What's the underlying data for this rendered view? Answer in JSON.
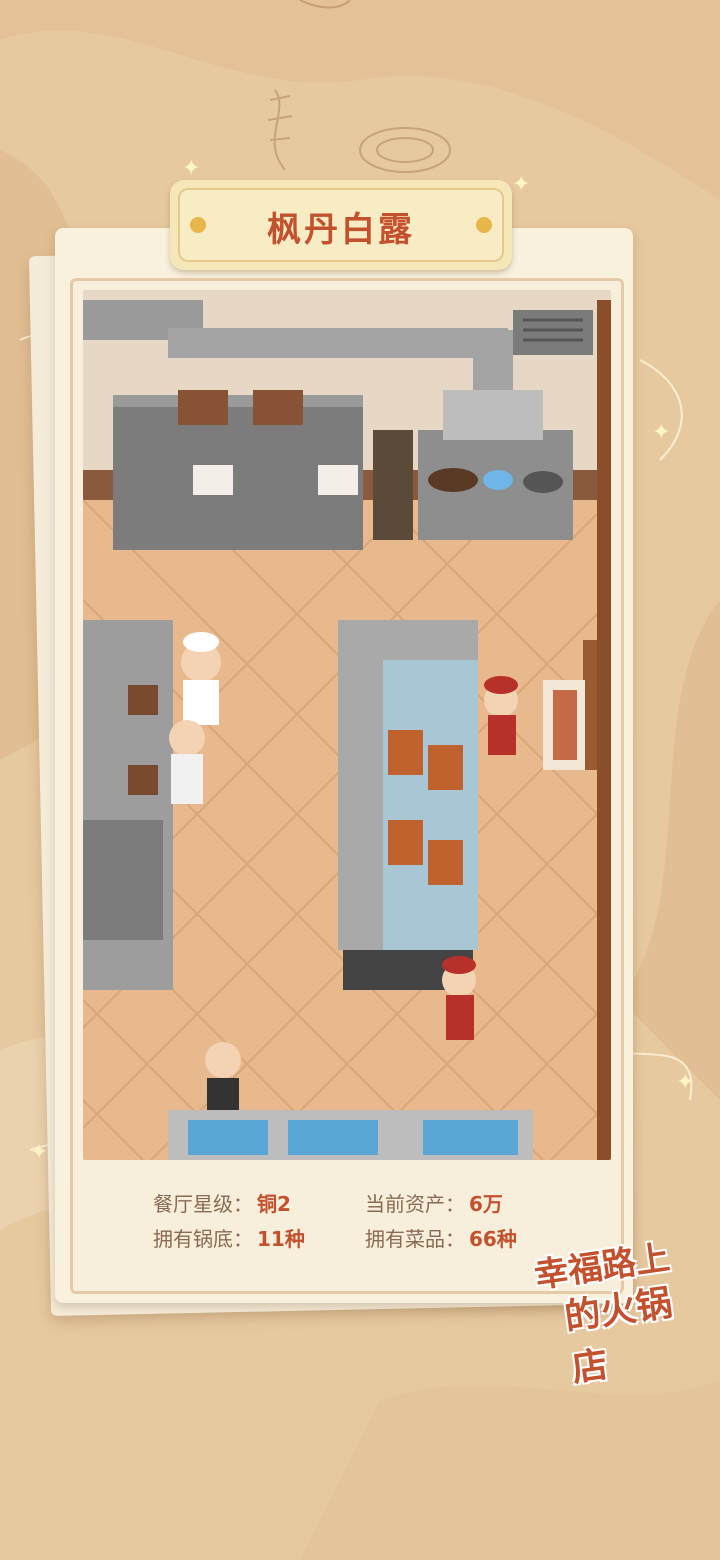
{
  "restaurant": {
    "name": "枫丹白露"
  },
  "stats": {
    "star_level_label": "餐厅星级：",
    "star_level_value": "铜2",
    "assets_label": "当前资产：",
    "assets_value": "6万",
    "soup_bases_label": "拥有锅底：",
    "soup_bases_value": "11种",
    "dishes_label": "拥有菜品：",
    "dishes_value": "66种"
  },
  "logo": {
    "line1": "幸福路上",
    "line2": "的火锅店"
  },
  "colors": {
    "accent": "#c4512e",
    "label": "#8a6a52",
    "background": "#e7c9a0",
    "card": "#f8f1de"
  }
}
